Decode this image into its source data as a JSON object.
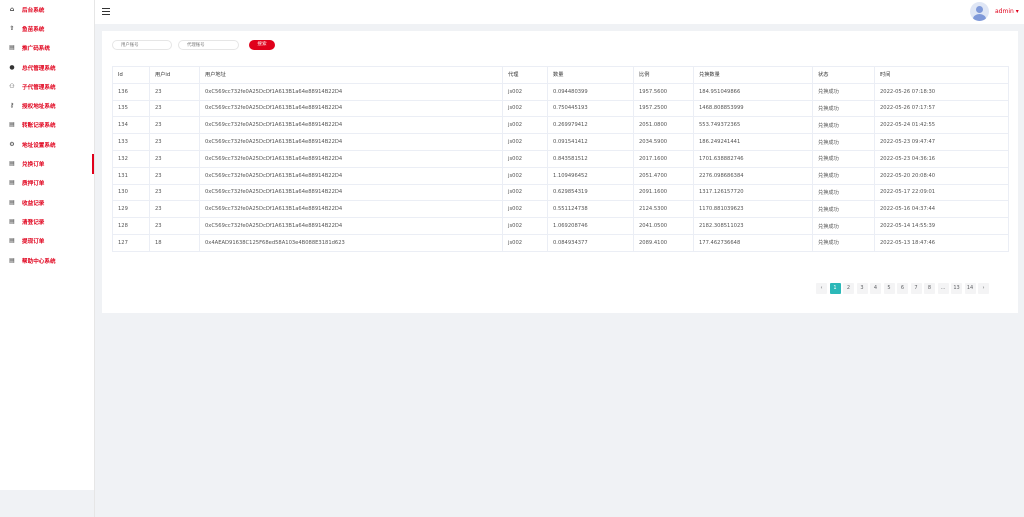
{
  "sidebar": {
    "items": [
      {
        "label": "后台系统",
        "icon": "home-icon",
        "active": false
      },
      {
        "label": "鱼苗系统",
        "icon": "up-arrow-icon",
        "active": false
      },
      {
        "label": "推广码系统",
        "icon": "document-icon",
        "active": false
      },
      {
        "label": "总代管理系统",
        "icon": "user-icon",
        "active": false
      },
      {
        "label": "子代管理系统",
        "icon": "users-icon",
        "active": false
      },
      {
        "label": "授权地址系统",
        "icon": "key-icon",
        "active": false
      },
      {
        "label": "转账记录系统",
        "icon": "list-icon",
        "active": false
      },
      {
        "label": "地址设置系统",
        "icon": "settings-icon",
        "active": false
      },
      {
        "label": "兑换订单",
        "icon": "list-icon",
        "active": true
      },
      {
        "label": "质押订单",
        "icon": "list-icon",
        "active": false
      },
      {
        "label": "收益记录",
        "icon": "list-icon",
        "active": false
      },
      {
        "label": "清登记录",
        "icon": "list-icon",
        "active": false
      },
      {
        "label": "提现订单",
        "icon": "list-icon",
        "active": false
      },
      {
        "label": "帮助中心系统",
        "icon": "list-icon",
        "active": false
      }
    ]
  },
  "header": {
    "user": "admin ▾"
  },
  "search": {
    "user_placeholder": "用户账号",
    "agent_placeholder": "代理账号",
    "button_label": "搜索"
  },
  "table": {
    "columns": [
      "Id",
      "用户id",
      "用户地址",
      "代理",
      "数量",
      "比例",
      "兑换数量",
      "状态",
      "时间"
    ],
    "rows": [
      [
        "136",
        "23",
        "0xC569cc732fe0A25DcDf1A613B1a64e88914B22D4",
        "js002",
        "0.094480399",
        "1957.5600",
        "184.951049866",
        "兑换成功",
        "2022-05-26 07:18:30"
      ],
      [
        "135",
        "23",
        "0xC569cc732fe0A25DcDf1A613B1a64e88914B22D4",
        "js002",
        "0.750445193",
        "1957.2500",
        "1468.808853999",
        "兑换成功",
        "2022-05-26 07:17:57"
      ],
      [
        "134",
        "23",
        "0xC569cc732fe0A25DcDf1A613B1a64e88914B22D4",
        "js002",
        "0.269979412",
        "2051.0800",
        "553.749372365",
        "兑换成功",
        "2022-05-24 01:42:55"
      ],
      [
        "133",
        "23",
        "0xC569cc732fe0A25DcDf1A613B1a64e88914B22D4",
        "js002",
        "0.091541412",
        "2034.5900",
        "186.249241441",
        "兑换成功",
        "2022-05-23 09:47:47"
      ],
      [
        "132",
        "23",
        "0xC569cc732fe0A25DcDf1A613B1a64e88914B22D4",
        "js002",
        "0.843581512",
        "2017.1600",
        "1701.638882746",
        "兑换成功",
        "2022-05-23 04:36:16"
      ],
      [
        "131",
        "23",
        "0xC569cc732fe0A25DcDf1A613B1a64e88914B22D4",
        "js002",
        "1.109496452",
        "2051.4700",
        "2276.098686384",
        "兑换成功",
        "2022-05-20 20:08:40"
      ],
      [
        "130",
        "23",
        "0xC569cc732fe0A25DcDf1A613B1a64e88914B22D4",
        "js002",
        "0.629854319",
        "2091.1600",
        "1317.126157720",
        "兑换成功",
        "2022-05-17 22:09:01"
      ],
      [
        "129",
        "23",
        "0xC569cc732fe0A25DcDf1A613B1a64e88914B22D4",
        "js002",
        "0.551124738",
        "2124.5300",
        "1170.881039623",
        "兑换成功",
        "2022-05-16 04:37:44"
      ],
      [
        "128",
        "23",
        "0xC569cc732fe0A25DcDf1A613B1a64e88914B22D4",
        "js002",
        "1.069208746",
        "2041.0500",
        "2182.308511023",
        "兑换成功",
        "2022-05-14 14:55:39"
      ],
      [
        "127",
        "18",
        "0x4AEAD91638C125F68ed58A103e4B088E3181d623",
        "js002",
        "0.084934377",
        "2089.4100",
        "177.462736648",
        "兑换成功",
        "2022-05-13 18:47:46"
      ]
    ]
  },
  "pagination": {
    "prev": "‹",
    "next": "›",
    "pages": [
      "1",
      "2",
      "3",
      "4",
      "5",
      "6",
      "7",
      "8",
      "...",
      "13",
      "14"
    ],
    "active_page": "1"
  },
  "colors": {
    "accent": "#e0001b",
    "pager_active": "#2bb8b8"
  }
}
